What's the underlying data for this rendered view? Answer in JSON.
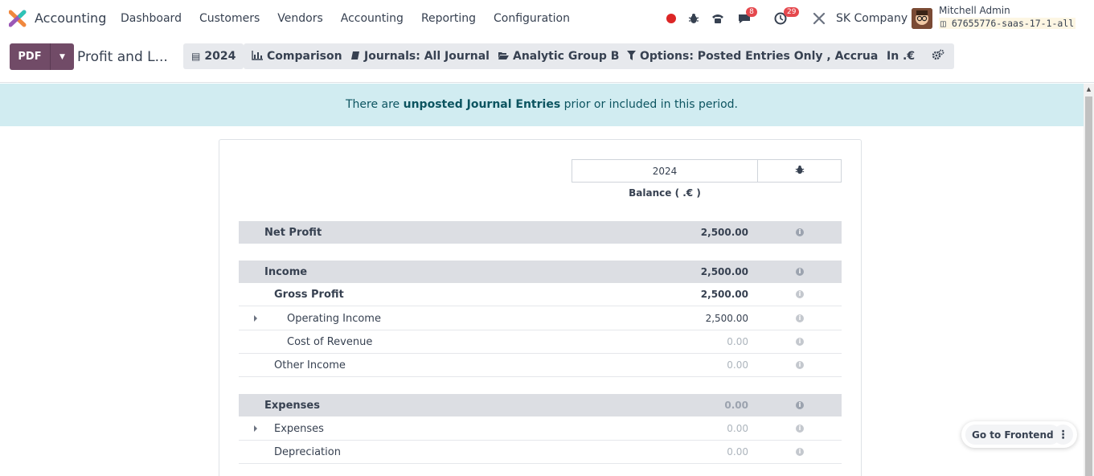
{
  "navbar": {
    "app_name": "Accounting",
    "menu": [
      "Dashboard",
      "Customers",
      "Vendors",
      "Accounting",
      "Reporting",
      "Configuration"
    ],
    "messages_badge": "8",
    "activities_badge": "29",
    "company": "SK Company",
    "user_name": "Mitchell Admin",
    "database": "67655776-saas-17-1-all",
    "icons": [
      "recording-dot-icon",
      "bug-icon",
      "phone-icon",
      "chat-icon",
      "clock-icon",
      "tools-icon"
    ]
  },
  "controls": {
    "pdf_label": "PDF",
    "page_title": "Profit and L...",
    "filters": [
      {
        "icon": "calendar-icon",
        "label": "2024"
      },
      {
        "icon": "bar-chart-icon",
        "label": "Comparison"
      },
      {
        "icon": "book-icon",
        "label": "Journals: All Journals"
      },
      {
        "icon": "folder-open-icon",
        "label": "Analytic Group By"
      },
      {
        "icon": "filter-icon",
        "label": "Options: Posted Entries Only , Accrual Basis"
      },
      {
        "icon": "",
        "label": "In .€"
      },
      {
        "icon": "cogs-icon",
        "label": ""
      }
    ]
  },
  "alert": {
    "prefix": "There are ",
    "link": "unposted Journal Entries",
    "suffix": " prior or included in this period."
  },
  "report": {
    "column_year": "2024",
    "balance_label": "Balance ( .€ )",
    "rows": [
      {
        "label": "Net Profit",
        "amount": "2,500.00"
      },
      {
        "label": "Income",
        "amount": "2,500.00"
      },
      {
        "label": "Gross Profit",
        "amount": "2,500.00"
      },
      {
        "label": "Operating Income",
        "amount": "2,500.00"
      },
      {
        "label": "Cost of Revenue",
        "amount": "0.00"
      },
      {
        "label": "Other Income",
        "amount": "0.00"
      },
      {
        "label": "Expenses",
        "amount": "0.00"
      },
      {
        "label": "Expenses",
        "amount": "0.00"
      },
      {
        "label": "Depreciation",
        "amount": "0.00"
      }
    ]
  },
  "floating": {
    "frontend_label": "Go to Frontend",
    "more_label": "⋮"
  },
  "colors": {
    "brand": "#714b67",
    "alert_bg": "#d1ecf1",
    "alert_text": "#0c5460",
    "section_bg": "#dcdee3"
  }
}
